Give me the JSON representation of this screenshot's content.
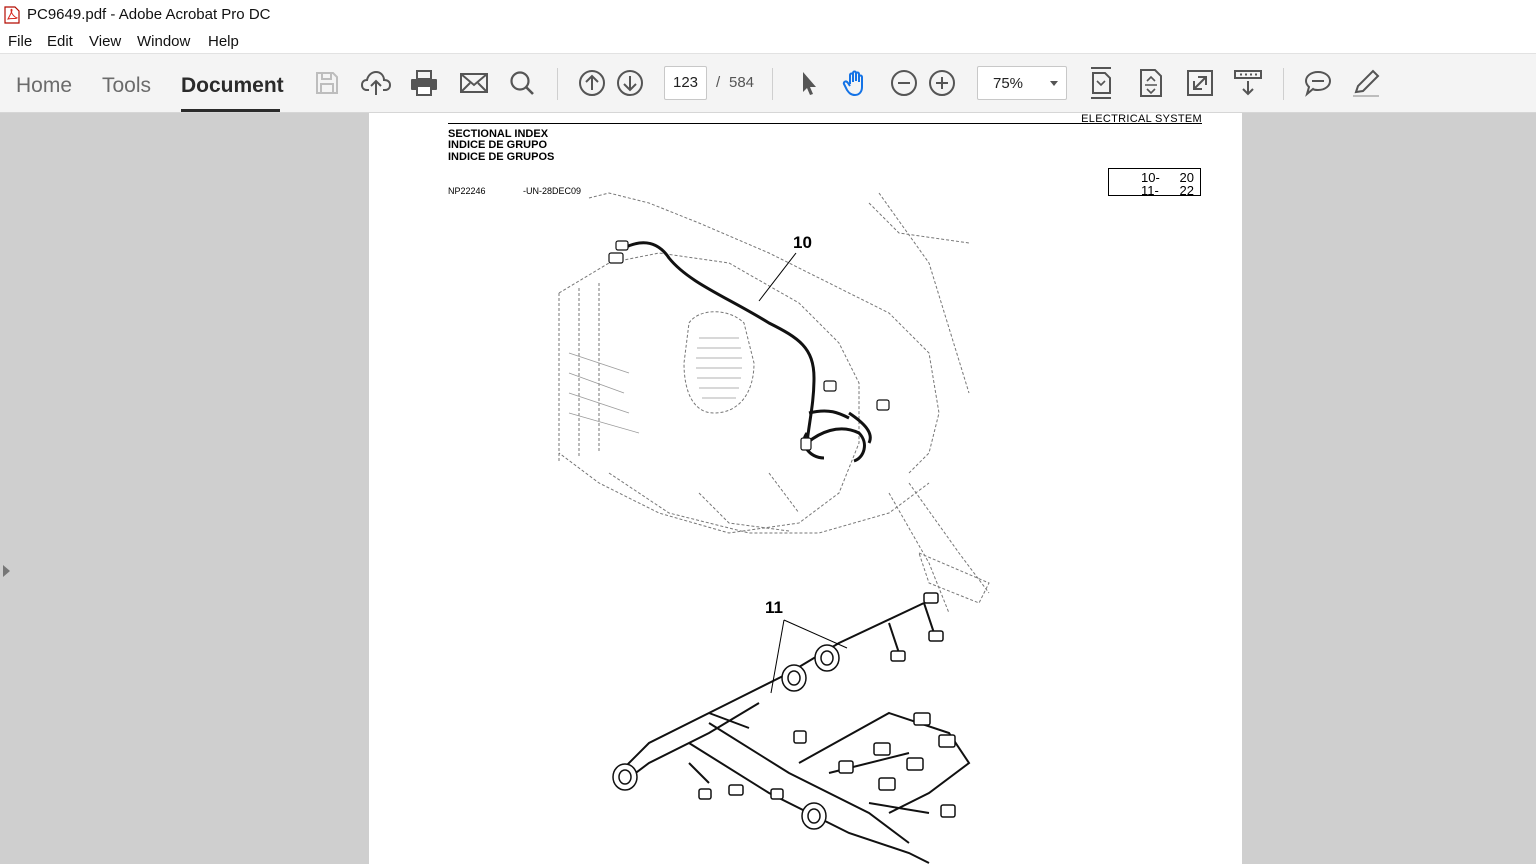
{
  "window": {
    "title": "PC9649.pdf - Adobe Acrobat Pro DC"
  },
  "menu": [
    "File",
    "Edit",
    "View",
    "Window",
    "Help"
  ],
  "tabs": {
    "home": "Home",
    "tools": "Tools",
    "document": "Document"
  },
  "navigation": {
    "current_page": "123",
    "separator": "/",
    "total_pages": "584"
  },
  "zoom": {
    "value": "75%"
  },
  "icons": {
    "save": "save-icon",
    "upload": "cloud-upload-icon",
    "print": "print-icon",
    "email": "envelope-icon",
    "search": "search-icon",
    "prev_page": "arrow-up-circle-icon",
    "next_page": "arrow-down-circle-icon",
    "select": "cursor-arrow-icon",
    "hand": "hand-icon",
    "zoom_out": "zoom-out-icon",
    "zoom_in": "zoom-in-icon",
    "fit_page": "fit-page-icon",
    "rotate": "rotate-view-icon",
    "full_screen": "full-screen-icon",
    "scroll_mode": "scroll-mode-icon",
    "comment": "comment-icon",
    "highlight": "pen-icon"
  },
  "document": {
    "section_header": "ELECTRICAL  SYSTEM",
    "title_lines": [
      "SECTIONAL INDEX",
      "INDICE DE GRUPO",
      "INDICE DE GRUPOS"
    ],
    "part_number": "NP22246",
    "date_code": "-UN-28DEC09",
    "index_table": [
      {
        "item": "10-",
        "ref": "20"
      },
      {
        "item": "11-",
        "ref": "22"
      }
    ],
    "callouts": [
      "10",
      "11"
    ]
  },
  "colors": {
    "toolbar_bg": "#f4f4f4",
    "viewer_bg": "#cfcfcf",
    "hand_tool_active": "#1473e6"
  }
}
